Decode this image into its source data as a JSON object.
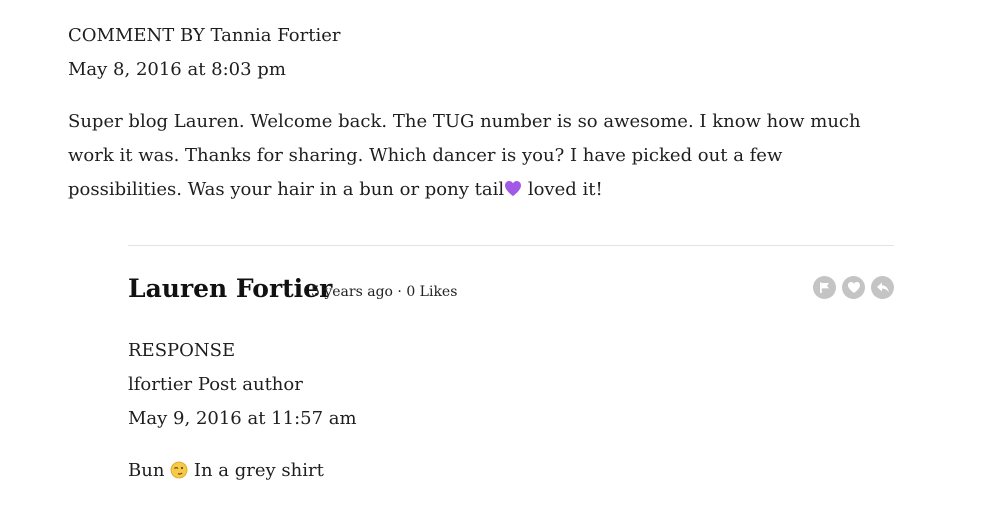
{
  "comment": {
    "label": "COMMENT BY Tannia Fortier",
    "date": "May 8, 2016 at 8:03 pm",
    "body_part1": "Super blog Lauren. Welcome back. The TUG number is so awesome. I know how much work it was. Thanks for sharing. Which dancer is you? I have picked out a few possibilities. Was your hair in a bun or pony tail",
    "body_part2": " loved it!"
  },
  "reply": {
    "author": "Lauren Fortier",
    "meta": "5 years ago · 0 Likes",
    "label": "RESPONSE",
    "author_line": "lfortier Post author",
    "date": "May 9, 2016 at 11:57 am",
    "body_part1": "Bun ",
    "body_part2": " In a grey shirt",
    "actions": [
      "flag-icon",
      "heart-icon",
      "reply-icon"
    ]
  },
  "colors": {
    "text": "#1e1e1e",
    "icon_bg": "#c4c4c4",
    "divider": "#e3e3e3",
    "heart_emoji": "#a259e6"
  }
}
